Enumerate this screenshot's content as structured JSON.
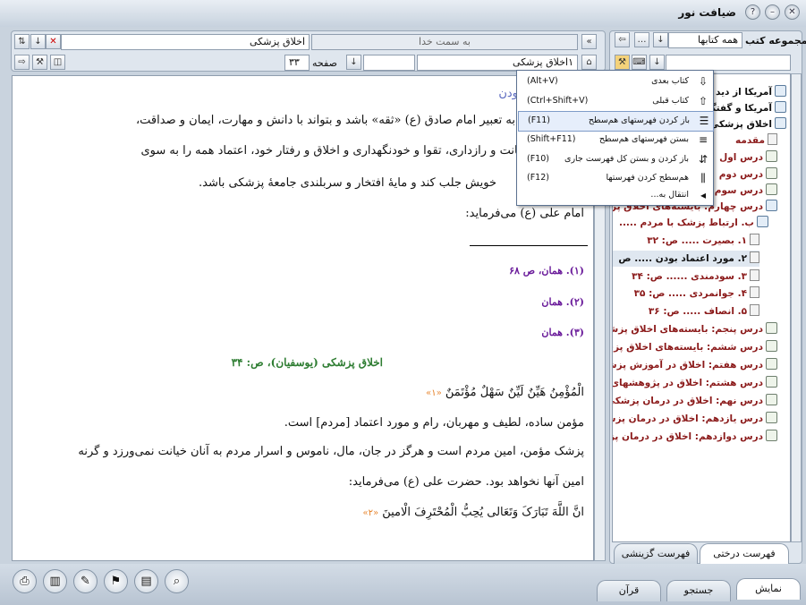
{
  "window": {
    "title": "ضیافت نور"
  },
  "left_panel": {
    "direction_field": "به سمت خدا",
    "book_field": "اخلاق پزشکی",
    "index_field": "۱اخلاق پزشکی",
    "page_label": "صفحه",
    "page_value": "۳۳"
  },
  "right_panel": {
    "collection_label": "مجموعه کتب",
    "all_books": "همه کتابها",
    "tab_tree": "فهرست درختی",
    "tab_history": "فهرست گزینشی"
  },
  "document": {
    "heading": "بودن",
    "lines": [
      "مورد اعتماد و به تعبیر امام صادق (ع) «ثقه» باشد و بتواند با دانش و مهارت، ایمان و صداقت،",
      "خیرخواهی، امانت و رازداری، تقوا و خودنگهداری و اخلاق و رفتار خود، اعتماد همه را به سوی",
      "خویش جلب کند و مایهٔ افتخار و سربلندی جامعهٔ پزشکی باشد.",
      "امام علی (ع) می‌فرماید:"
    ],
    "footnotes": [
      "(۱). همان، ص ۶۸",
      "(۲). همان",
      "(۳). همان"
    ],
    "source_title": "اخلاق  پزشکی  (یوسفیان)، ص:  ۳۴",
    "arabic_1": "الْمُؤْمِنُ هَیِّنٌ لَیِّنٌ سَهْلٌ مُؤْتَمَنٌ",
    "arabic_1_ref": "«۱»",
    "para_1": "مؤمن ساده، لطیف و مهربان، رام و مورد اعتماد [مردم] است.",
    "para_2": "پزشک مؤمن، امین مردم است و هرگز در جان، مال، ناموس و اسرار مردم به آنان خیانت نمی‌ورزد و گرنه",
    "para_3": "امین آنها نخواهد بود. حضرت علی (ع) می‌فرماید:",
    "arabic_2": "انَّ اللَّهَ تَبَارَکَ وَتَعَالی یُحِبُّ الْمُحْتَرِفَ الْامینَ",
    "arabic_2_ref": "«۲»"
  },
  "menu": {
    "items": [
      {
        "label": "کتاب بعدی",
        "shortcut": "(Alt+V)",
        "icon": "next-book-icon"
      },
      {
        "label": "کتاب قبلی",
        "shortcut": "(Ctrl+Shift+V)",
        "icon": "prev-book-icon"
      },
      {
        "label": "باز کردن فهرستهای هم‌سطح",
        "shortcut": "(F11)",
        "icon": "expand-level-icon"
      },
      {
        "label": "بستن فهرستهای هم‌سطح",
        "shortcut": "(Shift+F11)",
        "icon": "collapse-level-icon"
      },
      {
        "label": "باز کردن و بستن کل فهرست جاری",
        "shortcut": "(F10)",
        "icon": "toggle-all-icon"
      },
      {
        "label": "هم‌سطح کردن فهرستها",
        "shortcut": "(F12)",
        "icon": "align-level-icon"
      },
      {
        "label": "انتقال به...",
        "shortcut": "",
        "icon": "goto-arrow-icon"
      }
    ]
  },
  "tree": {
    "items": [
      {
        "text": "آمریکا از دید",
        "color": "#111111",
        "icon": "book",
        "indent": 0
      },
      {
        "text": "آمریکا و گفتگو",
        "color": "#111111",
        "icon": "book",
        "indent": 0
      },
      {
        "text": "اخلاق پزشکی",
        "color": "#111111",
        "icon": "book",
        "indent": 0
      },
      {
        "text": "مقدمه",
        "color": "#8b1a1a",
        "icon": "page",
        "indent": 1
      },
      {
        "text": "درس اول",
        "color": "#8b1a1a",
        "icon": "node",
        "indent": 1
      },
      {
        "text": "درس دوم",
        "color": "#8b1a1a",
        "icon": "node",
        "indent": 1
      },
      {
        "text": "درس سوم: بایسته‌های اخلاق پزشکی",
        "color": "#8b1a1a",
        "icon": "node",
        "indent": 1
      },
      {
        "text": "درس چهارم: بایسته‌های اخلاق پزشکی",
        "color": "#8b1a1a",
        "icon": "book",
        "indent": 1
      },
      {
        "text": "ب. ارتباط پزشک با مردم .....",
        "color": "#8b1a1a",
        "icon": "book",
        "indent": 2
      },
      {
        "text": "۱. بصیرت ..... ص: ۳۲",
        "color": "#8b1a1a",
        "icon": "page",
        "indent": 3
      },
      {
        "text": "۲. مورد اعتماد بودن ..... ص",
        "color": "#111111",
        "icon": "page",
        "indent": 3
      },
      {
        "text": "۳. سودمندی ...... ص: ۳۴",
        "color": "#8b1a1a",
        "icon": "page",
        "indent": 3
      },
      {
        "text": "۴. جوانمردی ..... ص: ۳۵",
        "color": "#8b1a1a",
        "icon": "page",
        "indent": 3
      },
      {
        "text": "۵. انصاف ..... ص: ۳۶",
        "color": "#8b1a1a",
        "icon": "page",
        "indent": 3
      },
      {
        "text": "درس پنجم: بایسته‌های اخلاق پزشکی",
        "color": "#8b1a1a",
        "icon": "node",
        "indent": 1
      },
      {
        "text": "درس ششم: بایسته‌های اخلاق پزشکی",
        "color": "#8b1a1a",
        "icon": "node",
        "indent": 1
      },
      {
        "text": "درس هفتم: اخلاق در آموزش پزشکی",
        "color": "#8b1a1a",
        "icon": "node",
        "indent": 1
      },
      {
        "text": "درس هشتم: اخلاق در پژوهشهای",
        "color": "#8b1a1a",
        "icon": "node",
        "indent": 1
      },
      {
        "text": "درس نهم: اخلاق در درمان پزشکی",
        "color": "#8b1a1a",
        "icon": "node",
        "indent": 1
      },
      {
        "text": "درس یازدهم: اخلاق در درمان پزشکی",
        "color": "#8b1a1a",
        "icon": "node",
        "indent": 1
      },
      {
        "text": "درس دوازدهم: اخلاق در درمان پزشکی",
        "color": "#8b1a1a",
        "icon": "node",
        "indent": 1
      }
    ]
  },
  "bottom_tabs": {
    "display": "نمایش",
    "search": "جستجو",
    "quran": "قرآن"
  },
  "colors": {
    "footnote": "#6a1b9a",
    "source": "#2e7d32",
    "arabic_ref": "#e67e22",
    "heading": "#5c6bc0"
  }
}
